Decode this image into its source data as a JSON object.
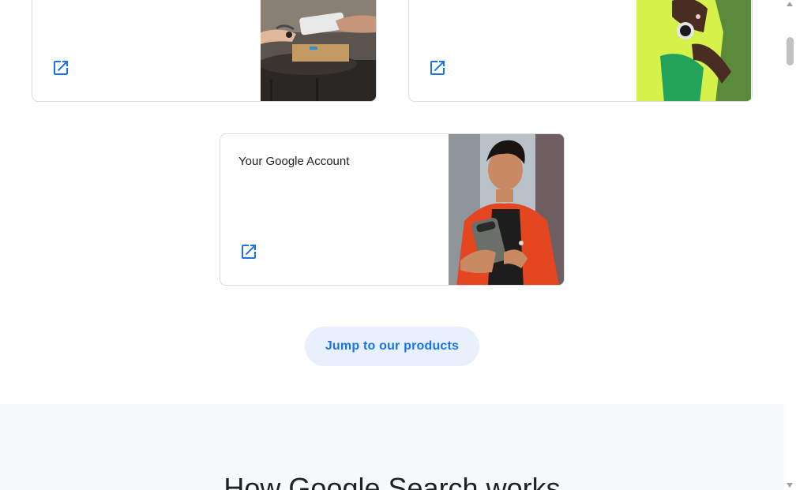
{
  "cards": [
    {
      "title": "",
      "icon": "open-in-new-icon",
      "image": "hands-payment-phone-photo"
    },
    {
      "title": "",
      "icon": "open-in-new-icon",
      "image": "smartwatch-wrist-photo"
    },
    {
      "title": "Your Google Account",
      "icon": "open-in-new-icon",
      "image": "man-with-phone-photo"
    }
  ],
  "cta": {
    "label": "Jump to our products"
  },
  "section": {
    "heading": "How Google Search works"
  },
  "colors": {
    "accent": "#1a73e8",
    "cta_bg": "#e8f0fe",
    "section_bg": "#f8f9fa",
    "border": "#dadce0"
  }
}
